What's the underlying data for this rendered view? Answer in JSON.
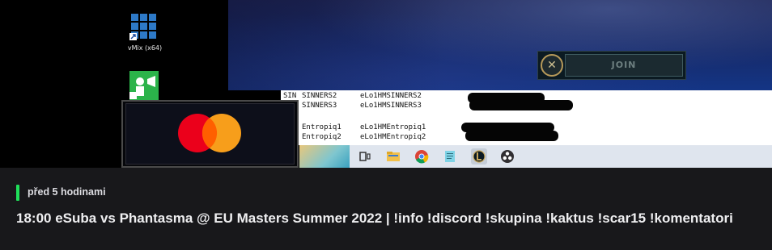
{
  "thumbnail": {
    "desktop": {
      "vmix_label": "vMix (x64)"
    },
    "join_panel": {
      "join_label": "JOIN",
      "close_glyph": "✕"
    },
    "text_panel": {
      "lines": [
        {
          "col0": "SIN",
          "col1": "SINNERS2",
          "col2": "eLo1HMSINNERS2"
        },
        {
          "col0": "",
          "col1": "SINNERS3",
          "col2": "eLo1HMSINNERS3"
        },
        {
          "col0": "",
          "col1": "Entropiq1",
          "col2": "eLo1HMEntropiq1"
        },
        {
          "col0": "",
          "col1": "Entropiq2",
          "col2": "eLo1HMEntropiq2"
        }
      ]
    },
    "taskbar_icons": [
      "task-view-icon",
      "file-explorer-icon",
      "chrome-icon",
      "notepad-icon",
      "league-client-icon",
      "obs-icon"
    ],
    "logo": "mastercard-logo"
  },
  "meta": {
    "time_ago": "před 5 hodinami"
  },
  "title": "18:00 eSuba vs Phantasma @ EU Masters Summer 2022 | !info !discord !skupina !kaktus !scar15 !komentatori",
  "colors": {
    "live_indicator": "#1fdf5a",
    "card_background": "#18181b",
    "title_text": "#efeff1"
  }
}
